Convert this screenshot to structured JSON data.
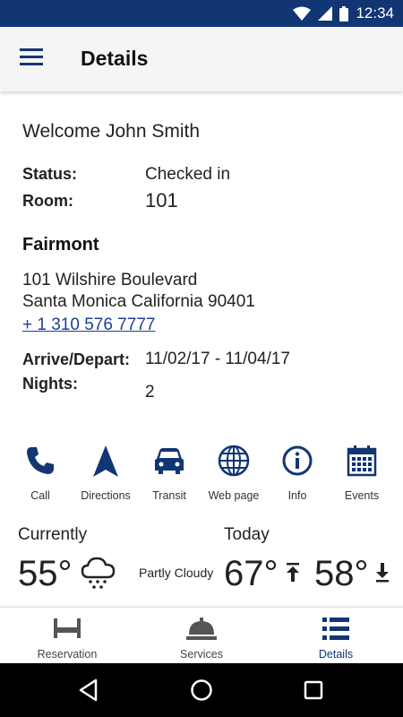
{
  "status_bar": {
    "time": "12:34"
  },
  "app_bar": {
    "title": "Details"
  },
  "details": {
    "welcome": "Welcome John Smith",
    "status_label": "Status:",
    "status_value": "Checked in",
    "room_label": "Room:",
    "room_value": "101",
    "hotel_name": "Fairmont",
    "address_line1": "101 Wilshire Boulevard",
    "address_line2": "Santa Monica California 90401",
    "phone": "+ 1 310 576 7777",
    "arrive_depart_label": "Arrive/Depart:",
    "arrive_depart_value": "11/02/17 - 11/04/17",
    "nights_label": "Nights:",
    "nights_value": "2"
  },
  "actions": [
    {
      "label": "Call",
      "icon": "phone-icon"
    },
    {
      "label": "Directions",
      "icon": "navigation-arrow-icon"
    },
    {
      "label": "Transit",
      "icon": "car-icon"
    },
    {
      "label": "Web page",
      "icon": "globe-icon"
    },
    {
      "label": "Info",
      "icon": "info-icon"
    },
    {
      "label": "Events",
      "icon": "calendar-icon"
    }
  ],
  "weather": {
    "currently_label": "Currently",
    "current_temp": "55°",
    "condition": "Partly Cloudy",
    "today_label": "Today",
    "high_temp": "67°",
    "low_temp": "58°"
  },
  "bottom_nav": [
    {
      "label": "Reservation",
      "icon": "bed-icon",
      "active": false
    },
    {
      "label": "Services",
      "icon": "service-bell-icon",
      "active": false
    },
    {
      "label": "Details",
      "icon": "list-icon",
      "active": true
    }
  ],
  "colors": {
    "primary": "#123574",
    "link": "#1c3f91",
    "icon_gray": "#555555"
  }
}
